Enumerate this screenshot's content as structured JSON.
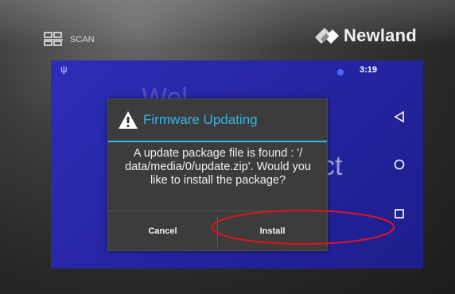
{
  "device": {
    "scan_label": "SCAN",
    "brand": "Newland"
  },
  "status_bar": {
    "usb_glyph": "ψ",
    "time": "3:19"
  },
  "background": {
    "word_1": "Wel",
    "word_2": "ct"
  },
  "dialog": {
    "title": "Firmware Updating",
    "message": "A update package file is found : '/ data/media/0/update.zip'. Would you like to install the package?",
    "cancel_label": "Cancel",
    "install_label": "Install"
  },
  "nav_icons": [
    "back-icon",
    "home-icon",
    "recents-icon"
  ],
  "colors": {
    "screen_blue": "#2424a0",
    "dialog_bg": "#3c3c3c",
    "accent": "#33b5e5",
    "annotation": "#e0141e"
  }
}
